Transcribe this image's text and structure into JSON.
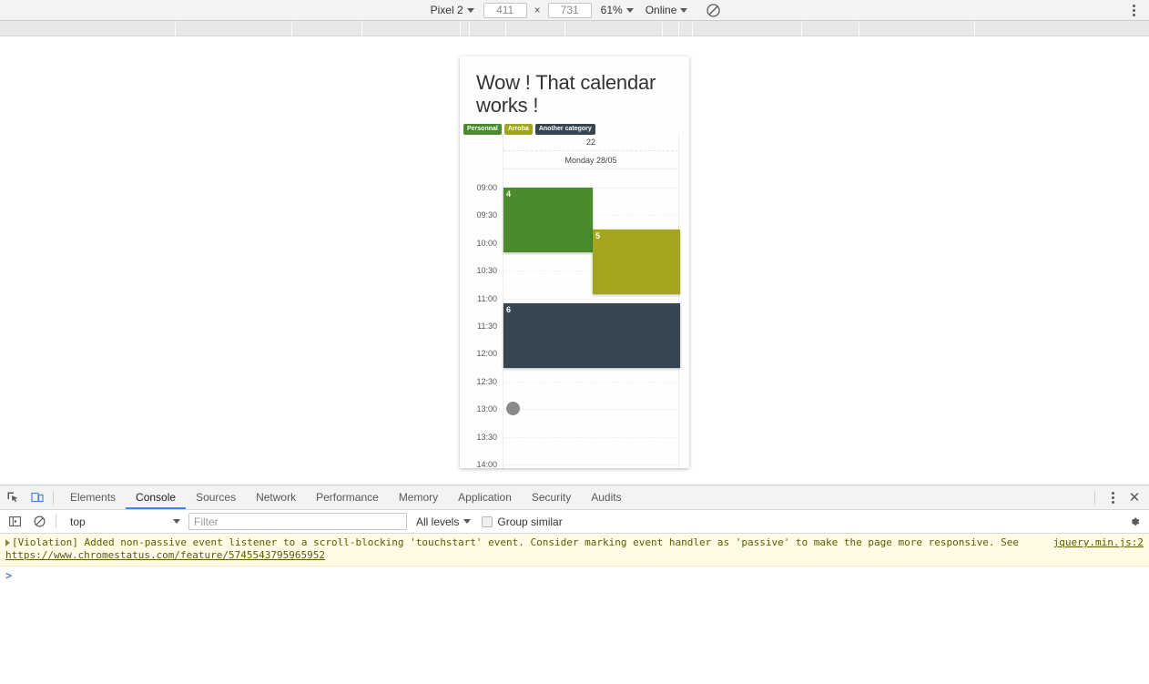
{
  "device_toolbar": {
    "device_name": "Pixel 2",
    "width": "411",
    "height": "731",
    "zoom": "61%",
    "throttling": "Online",
    "rotate_icon": "no-throttling-icon",
    "menu_icon": "kebab-menu-icon"
  },
  "page": {
    "card": {
      "title": "Wow ! That calendar works !",
      "badges": [
        {
          "label": "Personnal",
          "color": "#4a8b2c"
        },
        {
          "label": "Arroba",
          "color": "#a3a51f"
        },
        {
          "label": "Another category",
          "color": "#36454f"
        }
      ],
      "calendar": {
        "week_number": "22",
        "day_label": "Monday 28/05",
        "times": [
          "09:00",
          "09:30",
          "10:00",
          "10:30",
          "11:00",
          "11:30",
          "12:00",
          "12:30",
          "13:00",
          "13:30",
          "14:00"
        ],
        "events": [
          {
            "label": "4",
            "color": "#4a8b2c",
            "start": "09:00",
            "end": "10:10",
            "category": "Personnal"
          },
          {
            "label": "5",
            "color": "#a3a51f",
            "start": "09:45",
            "end": "10:55",
            "category": "Arroba"
          },
          {
            "label": "6",
            "color": "#36454f",
            "start": "11:05",
            "end": "12:15",
            "category": "Another category"
          }
        ],
        "marker": {
          "name": "drag-handle-dot",
          "time": "13:00",
          "color": "#8a8a8a"
        }
      }
    }
  },
  "devtools": {
    "tabs": [
      {
        "label": "Elements",
        "active": false
      },
      {
        "label": "Console",
        "active": true
      },
      {
        "label": "Sources",
        "active": false
      },
      {
        "label": "Network",
        "active": false
      },
      {
        "label": "Performance",
        "active": false
      },
      {
        "label": "Memory",
        "active": false
      },
      {
        "label": "Application",
        "active": false
      },
      {
        "label": "Security",
        "active": false
      },
      {
        "label": "Audits",
        "active": false
      }
    ],
    "inspect_icon": "inspect-element-icon",
    "device_icon": "device-toolbar-icon",
    "menu_icon": "kebab-menu-icon",
    "close_icon": "close-icon",
    "filter_bar": {
      "sidebar_icon": "console-sidebar-icon",
      "clear_icon": "clear-console-icon",
      "context": "top",
      "filter_placeholder": "Filter",
      "filter_value": "",
      "levels": "All levels",
      "group_similar": "Group similar",
      "group_similar_checked": false,
      "settings_icon": "gear-icon"
    },
    "console": {
      "message": "[Violation] Added non-passive event listener to a scroll-blocking 'touchstart' event. Consider marking event handler as 'passive' to make the page more responsive. See",
      "message_link": "https://www.chromestatus.com/feature/5745543795965952",
      "source": "jquery.min.js:2",
      "prompt": ">"
    }
  }
}
